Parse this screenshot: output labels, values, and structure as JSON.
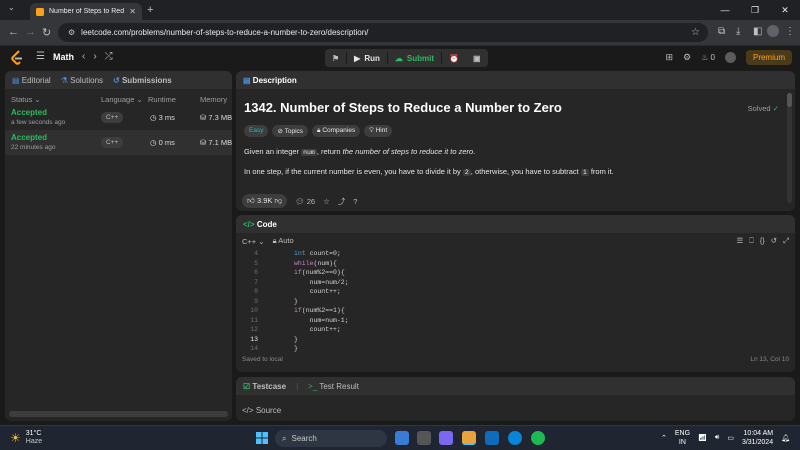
{
  "browser": {
    "tab_title": "Number of Steps to Reduce a N",
    "url": "leetcode.com/problems/number-of-steps-to-reduce-a-number-to-zero/description/"
  },
  "lc_header": {
    "problem_list_label": "Math",
    "run_label": "Run",
    "submit_label": "Submit",
    "streak_count": "0",
    "premium_label": "Premium"
  },
  "left_panel": {
    "tabs": [
      "Editorial",
      "Solutions",
      "Submissions"
    ],
    "columns": [
      "Status",
      "Language",
      "Runtime",
      "Memory"
    ],
    "rows": [
      {
        "status": "Accepted",
        "time": "a few seconds ago",
        "language": "C++",
        "runtime": "3 ms",
        "memory": "7.3 MB"
      },
      {
        "status": "Accepted",
        "time": "22 minutes ago",
        "language": "C++",
        "runtime": "0 ms",
        "memory": "7.1 MB"
      }
    ]
  },
  "description": {
    "tab_label": "Description",
    "title": "1342. Number of Steps to Reduce a Number to Zero",
    "solved_label": "Solved",
    "tags": [
      "Easy",
      "Topics",
      "Companies",
      "Hint"
    ],
    "p1_a": "Given an integer ",
    "p1_code": "num",
    "p1_b": ", return ",
    "p1_c": "the number of steps to reduce it to zero",
    "p1_d": ".",
    "p2_a": "In one step, if the current number is even, you have to divide it by ",
    "p2_code1": "2",
    "p2_b": ", otherwise, you have to subtract ",
    "p2_code2": "1",
    "p2_c": " from it.",
    "likes": "3.9K",
    "comments": "26"
  },
  "code_panel": {
    "tab_label": "Code",
    "language": "C++",
    "mode": "Auto",
    "lines": [
      {
        "n": "4",
        "text": "int count=0;"
      },
      {
        "n": "5",
        "text": "while(num){"
      },
      {
        "n": "6",
        "text": "if(num%2==0){"
      },
      {
        "n": "7",
        "text": "    num=num/2;"
      },
      {
        "n": "8",
        "text": "    count++;"
      },
      {
        "n": "9",
        "text": "}"
      },
      {
        "n": "10",
        "text": "if(num%2==1){"
      },
      {
        "n": "11",
        "text": "    num=num-1;"
      },
      {
        "n": "12",
        "text": "    count++;"
      },
      {
        "n": "13",
        "text": "}"
      },
      {
        "n": "14",
        "text": "}"
      }
    ],
    "saved_label": "Saved to local",
    "cursor_pos": "Ln 13, Col 10"
  },
  "test_panel": {
    "tab1": "Testcase",
    "tab2": "Test Result",
    "source_label": "Source"
  },
  "taskbar": {
    "temperature": "31°C",
    "weather": "Haze",
    "search_label": "Search",
    "lang1": "ENG",
    "lang2": "IN",
    "time": "10:04 AM",
    "date": "3/31/2024"
  }
}
